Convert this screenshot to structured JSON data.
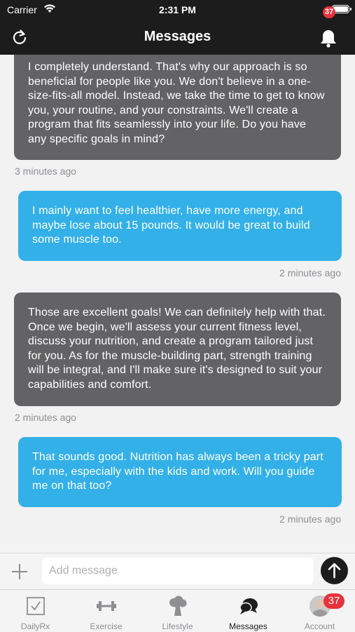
{
  "status_bar": {
    "carrier": "Carrier",
    "time": "2:31 PM"
  },
  "nav": {
    "title": "Messages",
    "notification_count": "37"
  },
  "messages": [
    {
      "direction": "incoming",
      "text": "I completely understand. That's why our approach is so beneficial for people like you. We don't believe in a one-size-fits-all model. Instead, we take the time to get to know you, your routine, and your constraints. We'll create a program that fits seamlessly into your life. Do you have any specific goals in mind?",
      "timestamp": "3 minutes ago"
    },
    {
      "direction": "outgoing",
      "text": "I mainly want to feel healthier, have more energy, and maybe lose about 15 pounds. It would be great to build some muscle too.",
      "timestamp": "2 minutes ago"
    },
    {
      "direction": "incoming",
      "text": "Those are excellent goals! We can definitely help with that. Once we begin, we'll assess your current fitness level, discuss your nutrition, and create a program tailored just for you. As for the muscle-building part, strength training will be integral, and I'll make sure it's designed to suit your capabilities and comfort.",
      "timestamp": "2 minutes ago"
    },
    {
      "direction": "outgoing",
      "text": "That sounds good. Nutrition has always been a tricky part for me, especially with the kids and work. Will you guide me on that too?",
      "timestamp": "2 minutes ago"
    }
  ],
  "composer": {
    "placeholder": "Add message",
    "value": ""
  },
  "tabs": [
    {
      "label": "DailyRx",
      "icon": "checkbox-icon",
      "active": false
    },
    {
      "label": "Exercise",
      "icon": "dumbbell-icon",
      "active": false
    },
    {
      "label": "Lifestyle",
      "icon": "broccoli-icon",
      "active": false
    },
    {
      "label": "Messages",
      "icon": "chat-bubbles-icon",
      "active": true
    },
    {
      "label": "Account",
      "icon": "avatar-icon",
      "active": false,
      "badge": "37"
    }
  ],
  "colors": {
    "bar": "#1c1c1c",
    "incoming": "#636366",
    "outgoing": "#33b0e8",
    "badge": "#e8323c"
  }
}
